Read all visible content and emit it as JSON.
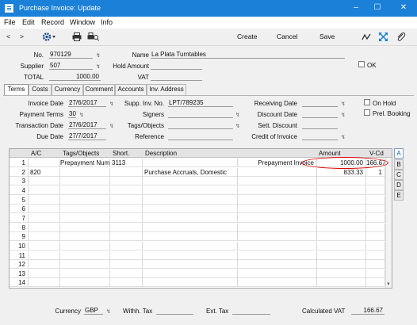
{
  "window": {
    "title": "Purchase Invoice: Update",
    "minimize": "–",
    "maximize": "☐",
    "close": "✕"
  },
  "menu": [
    "File",
    "Edit",
    "Record",
    "Window",
    "Info"
  ],
  "toolbar": {
    "prev": "<",
    "next": ">",
    "create": "Create",
    "cancel": "Cancel",
    "save": "Save"
  },
  "header": {
    "no_label": "No.",
    "no": "970129",
    "supplier_label": "Supplier",
    "supplier": "507",
    "total_label": "TOTAL",
    "total": "1000.00",
    "name_label": "Name",
    "name": "La Plata Turntables",
    "hold_amount_label": "Hold Amount",
    "hold_amount": "",
    "vat_label": "VAT",
    "vat": "",
    "ok_label": "OK"
  },
  "tabs": [
    "Terms",
    "Costs",
    "Currency",
    "Comment",
    "Accounts",
    "Inv. Address"
  ],
  "terms": {
    "invoice_date_label": "Invoice Date",
    "invoice_date": "27/6/2017",
    "payment_terms_label": "Payment Terms",
    "payment_terms": "30",
    "transaction_date_label": "Transaction Date",
    "transaction_date": "27/6/2017",
    "due_date_label": "Due Date",
    "due_date": "27/7/2017",
    "supp_inv_no_label": "Supp. Inv. No.",
    "supp_inv_no": "LPT/789235",
    "signers_label": "Signers",
    "signers": "",
    "tags_objects_label": "Tags/Objects",
    "tags_objects": "",
    "reference_label": "Reference",
    "reference": "",
    "receiving_date_label": "Receiving Date",
    "receiving_date": "",
    "discount_date_label": "Discount Date",
    "discount_date": "",
    "sett_discount_label": "Sett. Discount",
    "sett_discount": "",
    "credit_of_invoice_label": "Credit of Invoice",
    "credit_of_invoice": "",
    "on_hold_label": "On Hold",
    "prel_booking_label": "Prel. Booking"
  },
  "grid": {
    "headers": {
      "ac": "A/C",
      "tags": "Tags/Objects",
      "short": "Short.",
      "description": "Description",
      "amount": "Amount",
      "vcd": "V-Cd"
    },
    "rows": [
      {
        "n": "1",
        "ac": "",
        "tags": "Prepayment Number",
        "short": "3113",
        "description": "",
        "extra": "Prepayment Invoice",
        "amount": "1000.00",
        "vcd": "166.67"
      },
      {
        "n": "2",
        "ac": "820",
        "tags": "",
        "short": "",
        "description": "Purchase Accruals, Domestic",
        "extra": "",
        "amount": "833.33",
        "vcd": "1"
      },
      {
        "n": "3"
      },
      {
        "n": "4"
      },
      {
        "n": "5"
      },
      {
        "n": "6"
      },
      {
        "n": "7"
      },
      {
        "n": "8"
      },
      {
        "n": "9"
      },
      {
        "n": "10"
      },
      {
        "n": "11"
      },
      {
        "n": "12"
      },
      {
        "n": "13"
      },
      {
        "n": "14"
      }
    ],
    "side_tabs": [
      "A",
      "B",
      "C",
      "D",
      "E"
    ]
  },
  "footer": {
    "currency_label": "Currency",
    "currency": "GBP",
    "withh_tax_label": "Withh. Tax",
    "withh_tax": "",
    "ext_tax_label": "Ext. Tax",
    "ext_tax": "",
    "calc_vat_label": "Calculated VAT",
    "calc_vat": "166.67"
  },
  "colors": {
    "titlebar": "#1a80d8",
    "highlight_ring": "#e00000"
  }
}
